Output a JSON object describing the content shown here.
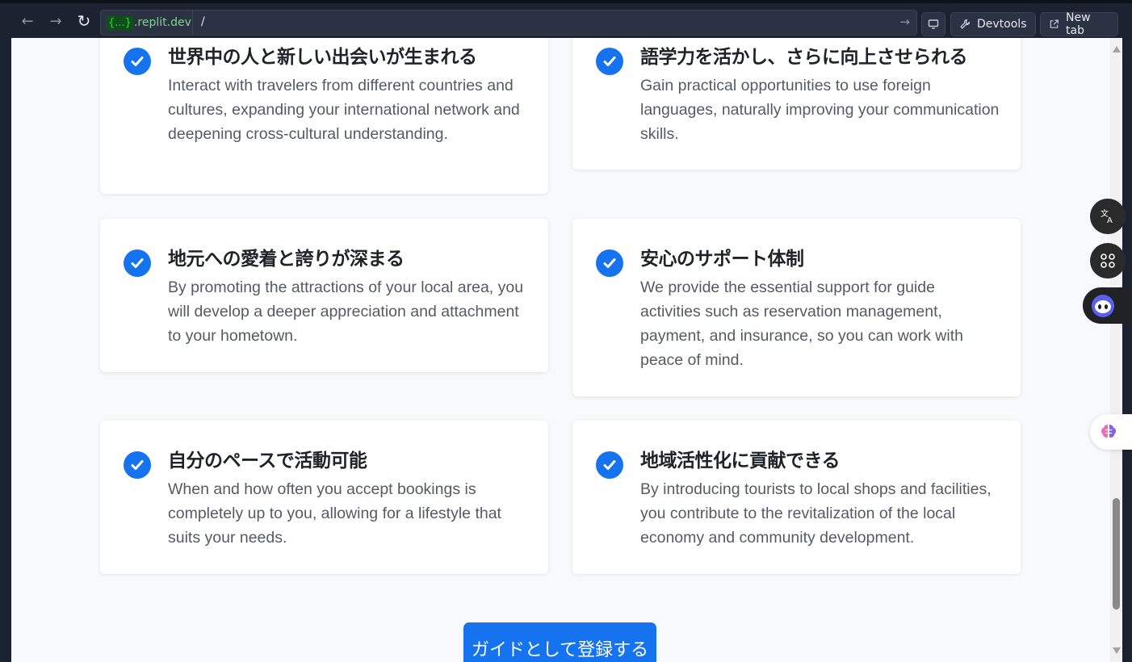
{
  "browser": {
    "url_badge": "{...}",
    "url_domain": ".replit.dev",
    "url_path": "/",
    "devtools_label": "Devtools",
    "new_tab_label": "New tab"
  },
  "cards": [
    {
      "title": "世界中の人と新しい出会いが生まれる",
      "body": "Interact with travelers from different countries and cultures, expanding your international network and deepening cross-cultural understanding."
    },
    {
      "title": "語学力を活かし、さらに向上させられる",
      "body": "Gain practical opportunities to use foreign languages, naturally improving your communication skills."
    },
    {
      "title": "地元への愛着と誇りが深まる",
      "body": "By promoting the attractions of your local area, you will develop a deeper appreciation and attachment to your hometown."
    },
    {
      "title": "安心のサポート体制",
      "body": "We provide the essential support for guide activities such as reservation management, payment, and insurance, so you can work with peace of mind."
    },
    {
      "title": "自分のペースで活動可能",
      "body": "When and how often you accept bookings is completely up to you, allowing for a lifestyle that suits your needs."
    },
    {
      "title": "地域活性化に貢献できる",
      "body": "By introducing tourists to local shops and facilities, you contribute to the revitalization of the local economy and community development."
    }
  ],
  "cta": {
    "label": "ガイドとして登録する"
  },
  "colors": {
    "accent": "#1673f0",
    "page_bg": "#f8f9fa",
    "card_bg": "#ffffff"
  },
  "icons": [
    "back-arrow-icon",
    "forward-arrow-icon",
    "reload-icon",
    "go-arrow-icon",
    "monitor-icon",
    "wrench-icon",
    "external-link-icon",
    "check-circle-icon",
    "translate-icon",
    "command-icon",
    "ai-assistant-icon",
    "brain-icon"
  ]
}
